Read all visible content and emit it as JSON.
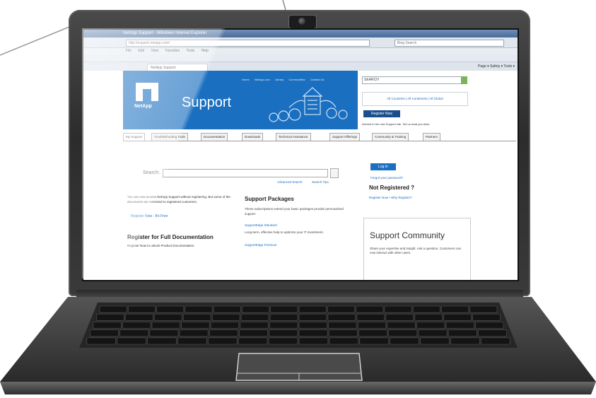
{
  "browser": {
    "window_title": "NetApp Support - Windows Internet Explorer",
    "address": "http://support.netapp.com/",
    "search_placeholder": "Bing Search",
    "menu": [
      "File",
      "Edit",
      "View",
      "Favorites",
      "Tools",
      "Help"
    ],
    "tab_title": "NetApp Support",
    "command_bar": "Page ▾  Safety ▾  Tools ▾"
  },
  "site": {
    "logo_text": "NetApp",
    "title": "Support",
    "top_links": [
      "Home",
      "NetApp.com",
      "Library",
      "Communities",
      "Contact Us"
    ],
    "search_box_text": "SEARCH",
    "languages": "All Countries | All Continents | All Global",
    "register_button": "Register Now",
    "register_note": "Interest in the new Support site. Tell us what you think",
    "nav_tabs": [
      "My Support",
      "Troubleshooting Tools",
      "Documentation",
      "Downloads",
      "Technical Assistance",
      "Support Offerings",
      "Community & Training",
      "Partners"
    ]
  },
  "search": {
    "label": "Search:",
    "advanced": "Advanced Search",
    "tips": "Search Tips"
  },
  "left": {
    "intro": "You can now access NetApp Support without registering. But some of the documents are restricted to registered customers.",
    "link": "Register Now - It's Free",
    "heading": "Register for Full Documentation",
    "sub": "Register Now to unlock Product Documentation"
  },
  "packages": {
    "heading": "Support Packages",
    "desc": "These subscriptions extend your basic packages provide personalized support.",
    "link1": "SupportEdge Standard",
    "desc2": "Long-term, effective help to optimize your IT investment.",
    "link2": "SupportEdge Premium"
  },
  "account": {
    "login": "Log In",
    "forgot": "Forgot your password?",
    "not_registered": "Not Registered ?",
    "links": "Register Now  •  Why Register?"
  },
  "community": {
    "title": "Support Community",
    "text": "Share your expertise and insight. Ask a question. Customers can now interact with other users."
  },
  "colors": {
    "brand_blue": "#1a6fc0",
    "laptop_body": "#3a3a3a",
    "keys": "#1c1c1c"
  }
}
